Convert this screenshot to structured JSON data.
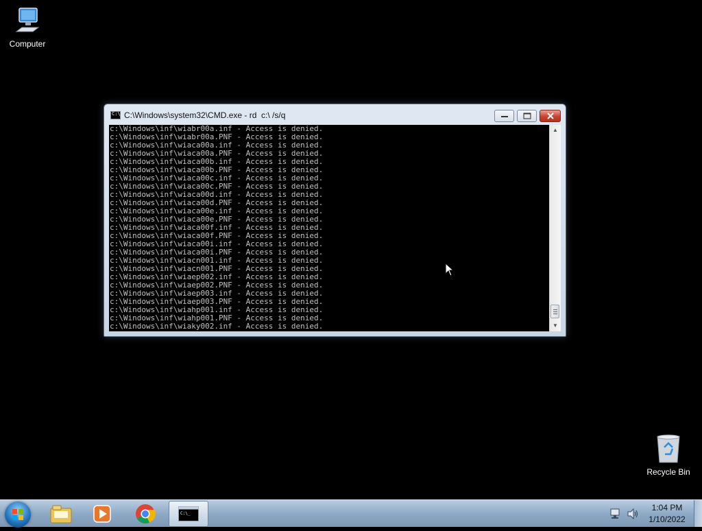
{
  "desktop": {
    "icons": [
      {
        "label": "Computer",
        "icon": "computer-icon"
      },
      {
        "label": "Recycle Bin",
        "icon": "recycle-bin-icon"
      }
    ]
  },
  "window": {
    "title": "C:\\Windows\\system32\\CMD.exe - rd  c:\\ /s/q",
    "icon": "cmd-icon",
    "buttons": [
      "minimize",
      "maximize",
      "close"
    ],
    "console_lines": [
      "c:\\Windows\\inf\\wiabr00a.inf - Access is denied.",
      "c:\\Windows\\inf\\wiabr00a.PNF - Access is denied.",
      "c:\\Windows\\inf\\wiaca00a.inf - Access is denied.",
      "c:\\Windows\\inf\\wiaca00a.PNF - Access is denied.",
      "c:\\Windows\\inf\\wiaca00b.inf - Access is denied.",
      "c:\\Windows\\inf\\wiaca00b.PNF - Access is denied.",
      "c:\\Windows\\inf\\wiaca00c.inf - Access is denied.",
      "c:\\Windows\\inf\\wiaca00c.PNF - Access is denied.",
      "c:\\Windows\\inf\\wiaca00d.inf - Access is denied.",
      "c:\\Windows\\inf\\wiaca00d.PNF - Access is denied.",
      "c:\\Windows\\inf\\wiaca00e.inf - Access is denied.",
      "c:\\Windows\\inf\\wiaca00e.PNF - Access is denied.",
      "c:\\Windows\\inf\\wiaca00f.inf - Access is denied.",
      "c:\\Windows\\inf\\wiaca00f.PNF - Access is denied.",
      "c:\\Windows\\inf\\wiaca00i.inf - Access is denied.",
      "c:\\Windows\\inf\\wiaca00i.PNF - Access is denied.",
      "c:\\Windows\\inf\\wiacn001.inf - Access is denied.",
      "c:\\Windows\\inf\\wiacn001.PNF - Access is denied.",
      "c:\\Windows\\inf\\wiaep002.inf - Access is denied.",
      "c:\\Windows\\inf\\wiaep002.PNF - Access is denied.",
      "c:\\Windows\\inf\\wiaep003.inf - Access is denied.",
      "c:\\Windows\\inf\\wiaep003.PNF - Access is denied.",
      "c:\\Windows\\inf\\wiahp001.inf - Access is denied.",
      "c:\\Windows\\inf\\wiahp001.PNF - Access is denied.",
      "c:\\Windows\\inf\\wiaky002.inf - Access is denied."
    ]
  },
  "taskbar": {
    "start_icon": "windows-orb-icon",
    "pinned": [
      "file-explorer-icon",
      "media-player-icon",
      "chrome-icon",
      "cmd-icon"
    ],
    "tray": [
      "network-icon",
      "volume-icon"
    ],
    "clock": {
      "time": "1:04 PM",
      "date": "1/10/2022"
    }
  },
  "colors": {
    "console_bg": "#000000",
    "console_text": "#c0c0c0",
    "close_button": "#c8452f"
  }
}
